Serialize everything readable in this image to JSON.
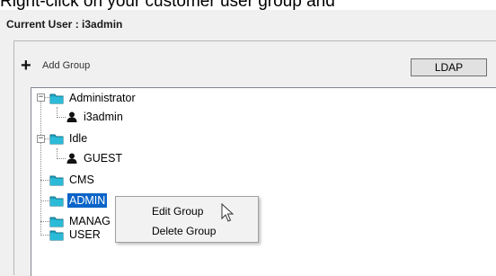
{
  "caption": {
    "text": "Right-click on your customer user group and"
  },
  "header": {
    "current_user": "Current User : i3admin"
  },
  "toolbar": {
    "add_group_label": "Add Group",
    "ldap_label": "LDAP"
  },
  "tree": {
    "nodes": [
      {
        "label": "Administrator",
        "type": "group",
        "expander": "−"
      },
      {
        "label": "i3admin",
        "type": "user"
      },
      {
        "label": "Idle",
        "type": "group",
        "expander": "−"
      },
      {
        "label": "GUEST",
        "type": "user"
      },
      {
        "label": "CMS",
        "type": "group"
      },
      {
        "label": "ADMIN",
        "type": "group",
        "selected": true
      },
      {
        "label": "MANAG",
        "type": "group"
      },
      {
        "label": "USER",
        "type": "group"
      }
    ]
  },
  "context_menu": {
    "items": [
      "Edit Group",
      "Delete Group"
    ]
  },
  "colors": {
    "selection": "#0a64c8",
    "folder": "#1fa6c4",
    "panel": "#f0f0f0"
  }
}
